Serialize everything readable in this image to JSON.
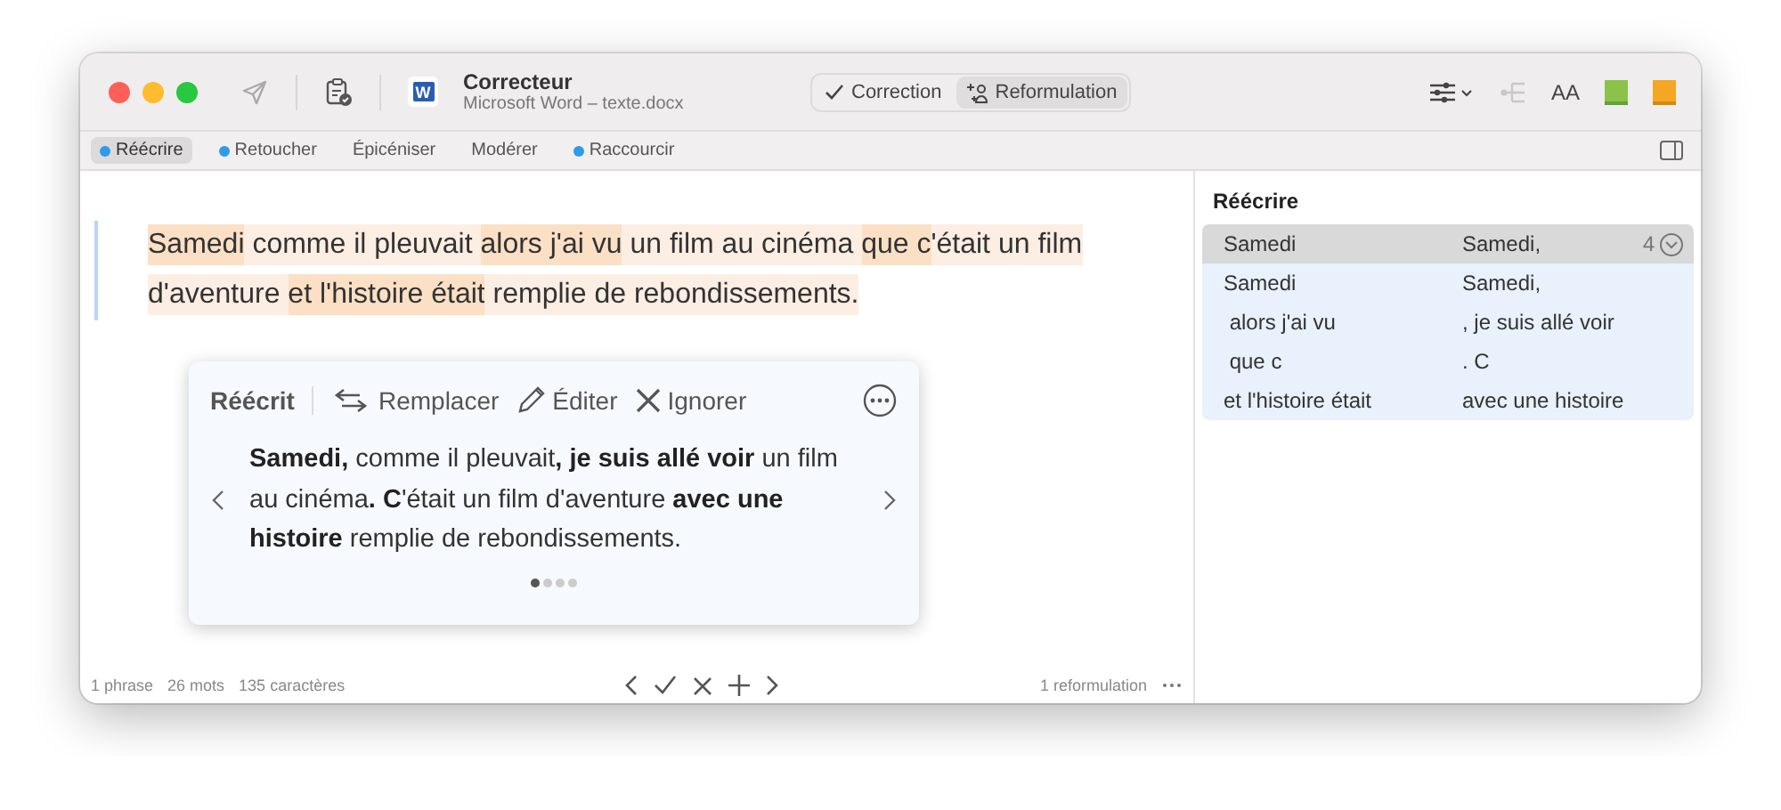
{
  "window": {
    "title": "Correcteur",
    "subtitle": "Microsoft Word – texte.docx",
    "app_letter": "W",
    "text_size_label": "AA"
  },
  "mode_tabs": [
    {
      "label": "Correction",
      "selected": false
    },
    {
      "label": "Reformulation",
      "selected": true
    }
  ],
  "categories": [
    {
      "label": "Réécrire",
      "selected": true,
      "dotted": true
    },
    {
      "label": "Retoucher",
      "selected": false,
      "dotted": true
    },
    {
      "label": "Épicéniser",
      "selected": false,
      "dotted": false
    },
    {
      "label": "Modérer",
      "selected": false,
      "dotted": false
    },
    {
      "label": "Raccourcir",
      "selected": false,
      "dotted": true
    }
  ],
  "document": {
    "segments": [
      {
        "text": "Samedi",
        "kind": "strong"
      },
      {
        "text": " comme il pleuvait ",
        "kind": "light"
      },
      {
        "text": "alors j'ai vu",
        "kind": "strong"
      },
      {
        "text": " un film au cinéma ",
        "kind": "light"
      },
      {
        "text": "que c",
        "kind": "strong"
      },
      {
        "text": "'était un film d'aventure ",
        "kind": "light"
      },
      {
        "text": "et l'histoire était",
        "kind": "strong"
      },
      {
        "text": " remplie de rebondissements.",
        "kind": "light"
      }
    ]
  },
  "popup": {
    "title": "Réécrit",
    "actions": [
      "Remplacer",
      "Éditer",
      "Ignorer"
    ],
    "suggestion": "**Samedi,** comme il pleuvait**, je suis allé voir** un film au cinéma**. C**'était un film d'aventure **avec une histoire** remplie de rebondissements.",
    "pages": [
      {
        "selected": true
      },
      {
        "selected": false
      },
      {
        "selected": false
      },
      {
        "selected": false
      }
    ]
  },
  "status_bar": {
    "stats": [
      "1 phrase",
      "26 mots",
      "135 caractères"
    ],
    "reformulations": "1 reformulation"
  },
  "side_panel": {
    "title": "Réécrire",
    "rows": [
      {
        "original": "Samedi",
        "replacement": "Samedi,",
        "count": "4",
        "selected": true,
        "expanded": true,
        "children": [
          {
            "original": "Samedi",
            "replacement": "Samedi,"
          },
          {
            "original": " alors j'ai vu",
            "replacement": ", je suis allé voir"
          },
          {
            "original": " que c",
            "replacement": ". C"
          },
          {
            "original": "et l'histoire était",
            "replacement": "avec une histoire"
          }
        ]
      }
    ]
  }
}
